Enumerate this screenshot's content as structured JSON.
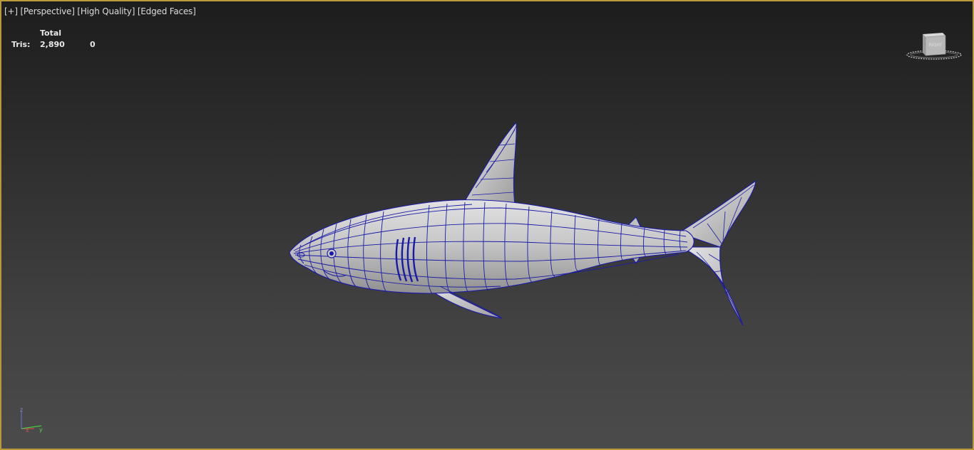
{
  "viewport": {
    "plus_label": "[+]",
    "view_label": "[Perspective]",
    "quality_label": "[High Quality]",
    "shading_label": "[Edged Faces]"
  },
  "stats": {
    "header": "Total",
    "label": "Tris:",
    "total_value": "2,890",
    "selected_value": "0"
  },
  "viewcube": {
    "face_label": "RIGHT",
    "icon": "view-cube-icon"
  },
  "axis": {
    "icon": "axis-tripod-icon",
    "z_label": "z",
    "x_label": "x",
    "y_label": "y"
  },
  "colors": {
    "border": "#b89a3a",
    "wire": "#1a1aa8",
    "mesh": "#c6c6c6",
    "text": "#dcdcdc"
  }
}
